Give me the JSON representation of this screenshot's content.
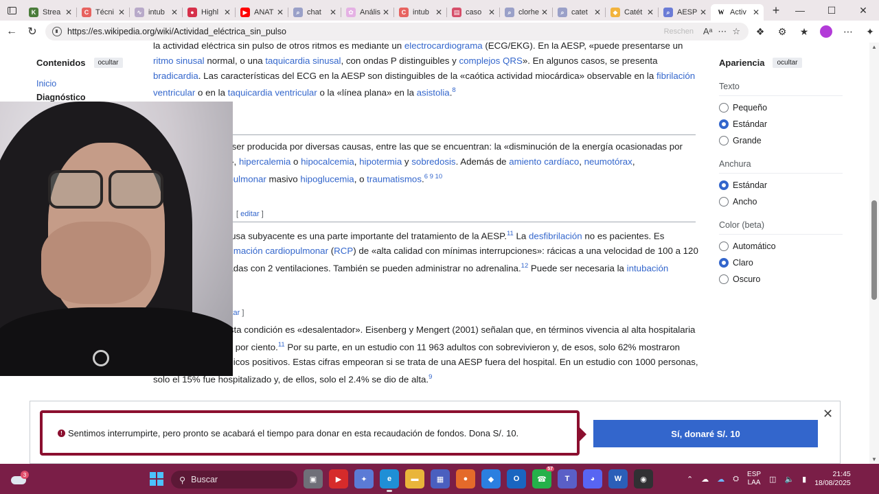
{
  "tabs": [
    {
      "title": "Strea",
      "fav_color": "#4a7c3a",
      "glyph": "K"
    },
    {
      "title": "Técni",
      "fav_color": "#e7625f",
      "glyph": "C"
    },
    {
      "title": "intub",
      "fav_color": "#b8a9c9",
      "glyph": "∿"
    },
    {
      "title": "Highl",
      "fav_color": "#d6304a",
      "glyph": "●"
    },
    {
      "title": "ANAT",
      "fav_color": "#ff0000",
      "glyph": "▶"
    },
    {
      "title": "chat",
      "fav_color": "#9aa0c8",
      "glyph": "⌕"
    },
    {
      "title": "Anális",
      "fav_color": "#e5b1e4",
      "glyph": "✿"
    },
    {
      "title": "intub",
      "fav_color": "#e7625f",
      "glyph": "C"
    },
    {
      "title": "caso",
      "fav_color": "#d64f6a",
      "glyph": "▤"
    },
    {
      "title": "clorhe",
      "fav_color": "#9aa0c8",
      "glyph": "⌕"
    },
    {
      "title": "catet",
      "fav_color": "#9aa0c8",
      "glyph": "⌕"
    },
    {
      "title": "Catét",
      "fav_color": "#f2b33d",
      "glyph": "◆"
    },
    {
      "title": "AESP",
      "fav_color": "#6b7bd6",
      "glyph": "⌕"
    },
    {
      "title": "Activ",
      "fav_color": "#ffffff",
      "glyph": "W",
      "active": true
    }
  ],
  "address": {
    "url": "https://es.wikipedia.org/wiki/Actividad_eléctrica_sin_pulso",
    "readmode": "Reschen"
  },
  "toc": {
    "title": "Contenidos",
    "hide": "ocultar",
    "items": [
      "Inicio",
      "Diagnóstico"
    ]
  },
  "article": {
    "p1": [
      {
        "t": "la actividad eléctrica sin pulso de otros ritmos es mediante un "
      },
      {
        "t": "electrocardiograma",
        "link": true
      },
      {
        "t": " (ECG/EKG). En la AESP, «puede presentarse un "
      },
      {
        "t": "ritmo sinusal",
        "link": true
      },
      {
        "t": " normal, o una "
      },
      {
        "t": "taquicardia sinusal",
        "link": true
      },
      {
        "t": ", con ondas P distinguibles y "
      },
      {
        "t": "complejos QRS",
        "link": true
      },
      {
        "t": "». En algunos casos, se presenta "
      },
      {
        "t": "bradicardia",
        "link": true
      },
      {
        "t": ". Las características del ECG en la AESP son distinguibles de la «caótica actividad miocárdica» observable en la "
      },
      {
        "t": "fibrilación ventricular",
        "link": true
      },
      {
        "t": " o en la "
      },
      {
        "t": "taquicardia ventricular",
        "link": true
      },
      {
        "t": " o la «línea plana» en la "
      },
      {
        "t": "asistolia",
        "link": true
      },
      {
        "t": ".",
        "sup": "8"
      }
    ],
    "p2": [
      {
        "t": "ca sin pulso puede ser producida por diversas causas, entre las que se encuentran: la «disminución de la energía ocasionadas por "
      },
      {
        "t": "isquemia",
        "link": true
      },
      {
        "t": " o "
      },
      {
        "t": "hipoxia",
        "link": true
      },
      {
        "t": "», "
      },
      {
        "t": "hipercalemia",
        "link": true
      },
      {
        "t": " o "
      },
      {
        "t": "hipocalcemia",
        "link": true
      },
      {
        "t": ", "
      },
      {
        "t": "hipotermia",
        "link": true
      },
      {
        "t": " y "
      },
      {
        "t": "sobredosis",
        "link": true
      },
      {
        "t": ". Además de "
      },
      {
        "t": "amiento cardíaco",
        "link": true
      },
      {
        "t": ", "
      },
      {
        "t": "neumotórax",
        "link": true
      },
      {
        "t": ", "
      },
      {
        "t": "tromboembolismo pulmonar",
        "link": true
      },
      {
        "t": " masivo "
      },
      {
        "t": "hipoglucemia",
        "link": true
      },
      {
        "t": ", o "
      },
      {
        "t": "traumatismos",
        "link": true
      },
      {
        "t": ".",
        "sup": "6 9 10"
      }
    ],
    "edit1": {
      "open": "[ ",
      "label": "editar",
      "close": " ]"
    },
    "p3": [
      {
        "t": "ratamiento de la causa subyacente es una parte importante del tratamiento de la AESP.",
        "sup": "11"
      },
      {
        "t": "  La "
      },
      {
        "t": "desfibrilación",
        "link": true
      },
      {
        "t": " no es pacientes. Es necesaria una "
      },
      {
        "t": "reanimación cardiopulmonar",
        "link": true
      },
      {
        "t": " ("
      },
      {
        "t": "RCP",
        "link": true
      },
      {
        "t": ") de «alta calidad con mínimas interrupciones»: rácicas a una velocidad de 100 a 120 por minuto intercaladas con 2 ventilaciones. También se pueden administrar no adrenalina.",
        "sup": "12"
      },
      {
        "t": "  Puede ser necesaria la "
      },
      {
        "t": "intubación",
        "link": true
      },
      {
        "t": " endotraqueal.",
        "sup": "11"
      }
    ],
    "edit2": {
      "open": "",
      "label": "itar",
      "close": " ]"
    },
    "p4": [
      {
        "t": "os pacientes con esta condición es «desalentador». Eisenberg y Mengert (2001) señalan que, en términos vivencia al alta hospitalaria es del uno al cuatro por ciento.",
        "sup": "11"
      },
      {
        "t": "  Por su parte, en un estudio con 11 963 adultos con sobrevivieron y, de esos, solo 62% mostraron resultados neurológicos positivos. Estas cifras empeoran si se trata de una AESP fuera del hospital. En un estudio con 1000 personas, solo el 15% fue hospitalizado y, de ellos, solo el 2.4% se dio de alta.",
        "sup": "9"
      }
    ]
  },
  "appearance": {
    "title": "Apariencia",
    "hide": "ocultar",
    "sections": [
      {
        "label": "Texto",
        "options": [
          {
            "label": "Pequeño",
            "on": false
          },
          {
            "label": "Estándar",
            "on": true
          },
          {
            "label": "Grande",
            "on": false
          }
        ]
      },
      {
        "label": "Anchura",
        "options": [
          {
            "label": "Estándar",
            "on": true
          },
          {
            "label": "Ancho",
            "on": false
          }
        ]
      },
      {
        "label": "Color (beta)",
        "options": [
          {
            "label": "Automático",
            "on": false
          },
          {
            "label": "Claro",
            "on": true
          },
          {
            "label": "Oscuro",
            "on": false
          }
        ]
      }
    ]
  },
  "banner": {
    "message": "Sentimos interrumpirte, pero pronto se acabará el tiempo para donar en esta recaudación de fondos. Dona S/. 10.",
    "donate": "Sí, donaré S/. 10",
    "accent": "#8b0f2f",
    "button_color": "#3366cc"
  },
  "taskbar": {
    "weather_badge": "3",
    "search_placeholder": "Buscar",
    "apps": [
      {
        "name": "task-view",
        "glyph": "▣",
        "color": "#6f6f78"
      },
      {
        "name": "youtube",
        "glyph": "▶",
        "color": "#d62b2b"
      },
      {
        "name": "copilot",
        "glyph": "✦",
        "color": "#5b7bd6"
      },
      {
        "name": "edge",
        "glyph": "e",
        "color": "#1f8fd6",
        "active": true
      },
      {
        "name": "file-explorer",
        "glyph": "▬",
        "color": "#e9b53a"
      },
      {
        "name": "store",
        "glyph": "▦",
        "color": "#4a5fbf"
      },
      {
        "name": "firefox",
        "glyph": "●",
        "color": "#e46a2a"
      },
      {
        "name": "dropbox",
        "glyph": "◆",
        "color": "#2b7fe0"
      },
      {
        "name": "outlook",
        "glyph": "O",
        "color": "#1a65c0"
      },
      {
        "name": "whatsapp",
        "glyph": "☎",
        "color": "#25b14a",
        "badge": "57"
      },
      {
        "name": "teams",
        "glyph": "T",
        "color": "#5a5fc7"
      },
      {
        "name": "discord",
        "glyph": "◕",
        "color": "#5865f2"
      },
      {
        "name": "word",
        "glyph": "W",
        "color": "#2b5fb8"
      },
      {
        "name": "obs",
        "glyph": "◉",
        "color": "#303033"
      }
    ],
    "lang_top": "ESP",
    "lang_bottom": "LAA",
    "time": "21:45",
    "date": "18/08/2025"
  }
}
